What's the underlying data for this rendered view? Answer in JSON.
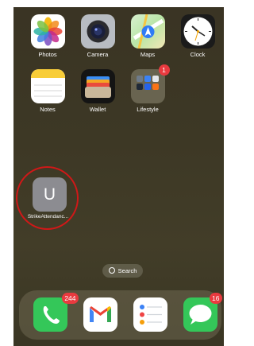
{
  "home_screen": {
    "row1": [
      {
        "label": "Photos",
        "icon": "photos-icon"
      },
      {
        "label": "Camera",
        "icon": "camera-icon"
      },
      {
        "label": "Maps",
        "icon": "maps-icon"
      },
      {
        "label": "Clock",
        "icon": "clock-icon"
      }
    ],
    "row2": [
      {
        "label": "Notes",
        "icon": "notes-icon"
      },
      {
        "label": "Wallet",
        "icon": "wallet-icon"
      },
      {
        "label": "Lifestyle",
        "icon": "folder-icon",
        "badge": "1"
      }
    ],
    "strike_app": {
      "label": "StrikeAttendanc...",
      "letter": "U",
      "icon": "strike-attendance-icon"
    },
    "search_pill": "Search",
    "dock": [
      {
        "icon": "phone-icon",
        "badge": "244"
      },
      {
        "icon": "gmail-icon"
      },
      {
        "icon": "reminders-icon"
      },
      {
        "icon": "messages-icon",
        "badge": "16"
      }
    ]
  },
  "colors": {
    "badge": "#e93a3f",
    "highlight_circle": "#d01818",
    "wallpaper": "#3d3825"
  }
}
